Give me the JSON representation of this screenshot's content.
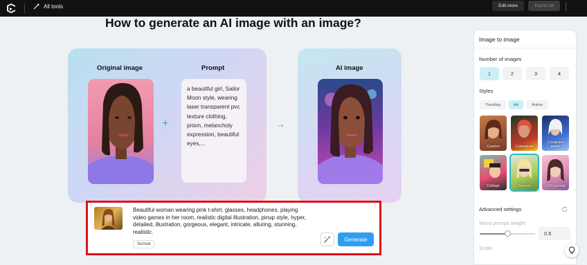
{
  "topbar": {
    "all_tools_label": "All tools",
    "edit_more_label": "Edit more",
    "export_all_label": "Export all",
    "logo_icon": "capcut-logo-icon",
    "all_tools_icon": "magic-wand-icon"
  },
  "main": {
    "heading": "How to generate an AI image with an image?",
    "original_label": "Original image",
    "prompt_label": "Prompt",
    "ai_label": "AI image",
    "prompt_text": "a beautiful girl, Sailor Moon style, wearing laser transparent pvc texture clothing, prism, melancholy expression, beautiful eyes,...",
    "plus_symbol": "+",
    "arrow_symbol": "→"
  },
  "bottom_panel": {
    "prompt_text": "Beautiful woman wearing pink t-shirt, glasses, headphones, playing video games in her room, realistic digital illustration, pinup style, hyper, detailed, illustration, gorgeous, elegant, intricate, alluring, stunning, realistic.",
    "style_chip": "Surreal",
    "generate_label": "Generate"
  },
  "sidebar": {
    "title": "Image to image",
    "number_of_images_label": "Number of images",
    "number_options": [
      "1",
      "2",
      "3",
      "4"
    ],
    "selected_number": "1",
    "styles_label": "Styles",
    "style_tabs": [
      "Trending",
      "Art",
      "Anime"
    ],
    "active_style_tab": "Art",
    "style_tiles": [
      "Custom",
      "Cyberpunk",
      "Computer game",
      "Collage",
      "Surreal",
      "CGI surreal"
    ],
    "selected_style": "Surreal",
    "advanced_settings_label": "Advanced settings",
    "word_prompt_weight_label": "Word prompt weight",
    "word_prompt_weight_value": "0.5",
    "scale_label": "Scale"
  },
  "colors": {
    "accent": "#2d9ef0",
    "teal": "#1fb6c9",
    "highlight_frame": "#e01118"
  }
}
